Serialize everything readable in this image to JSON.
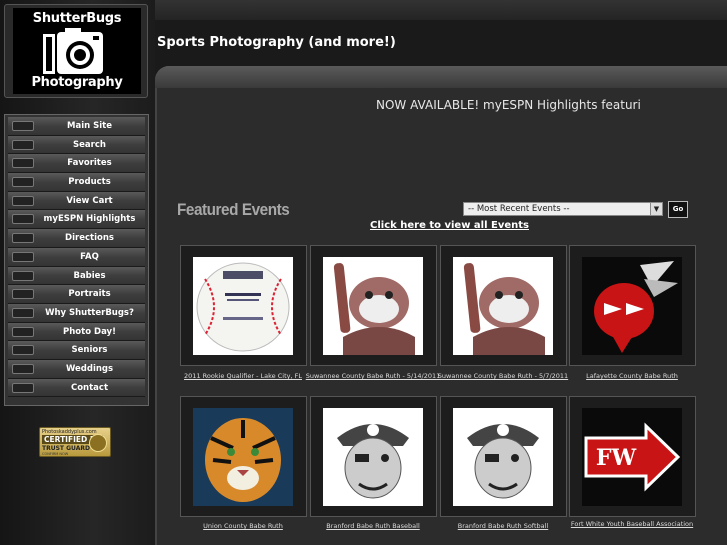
{
  "logo": {
    "top_text": "ShutterBugs",
    "bottom_text": "Photography"
  },
  "nav": {
    "items": [
      "Main Site",
      "Search",
      "Favorites",
      "Products",
      "View Cart",
      "myESPN Highlights",
      "Directions",
      "FAQ",
      "Babies",
      "Portraits",
      "Why ShutterBugs?",
      "Photo Day!",
      "Seniors",
      "Weddings",
      "Contact"
    ]
  },
  "trust_badge": {
    "site": "Photoskaddyplus.com",
    "certified": "CERTIFIED BY",
    "name": "TRUST GUARD",
    "sub": "CONFIRM NOW"
  },
  "header": {
    "site_title": "Sports Photography (and more!)"
  },
  "marquee": {
    "text": "NOW AVAILABLE! myESPN Highlights featuri"
  },
  "featured": {
    "heading": "Featured Events",
    "select_value": "-- Most Recent Events --",
    "go_label": "Go",
    "view_all": "Click here to view all Events"
  },
  "events": [
    {
      "label": "2011 Rookie Qualifier - Lake City, FL",
      "icon": "baseball-icon"
    },
    {
      "label": "Suwannee County Babe Ruth - 5/14/2011",
      "icon": "bulldog-bat-icon"
    },
    {
      "label": "Suwannee County Babe Ruth - 5/7/2011",
      "icon": "bulldog-bat-icon"
    },
    {
      "label": "Lafayette County Babe Ruth",
      "icon": "hornet-icon"
    },
    {
      "label": "Union County Babe Ruth",
      "icon": "tiger-icon"
    },
    {
      "label": "Branford Babe Ruth Baseball",
      "icon": "pirate-icon"
    },
    {
      "label": "Branford Babe Ruth Softball",
      "icon": "pirate-icon"
    },
    {
      "label": "Fort White Youth Baseball Association",
      "icon": "fw-arrowhead-icon",
      "thumb_text": "FW"
    }
  ],
  "colors": {
    "page_bg": "#1a1a1a",
    "panel_bg": "#2c2c2c",
    "nav_bg": "#333333",
    "accent_red": "#cc1111"
  }
}
